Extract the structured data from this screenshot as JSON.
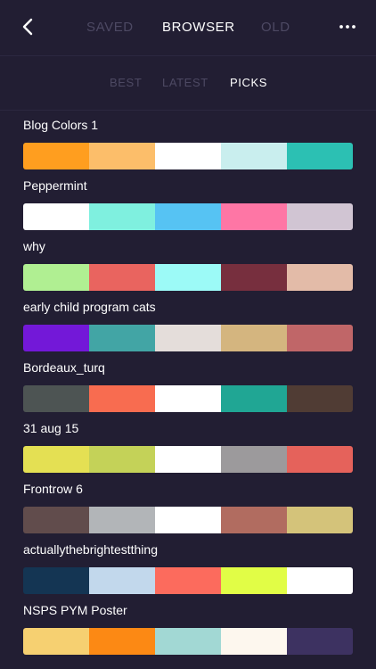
{
  "header": {
    "back_icon": "chevron-left-icon",
    "tabs": [
      {
        "label": "SAVED",
        "active": false
      },
      {
        "label": "BROWSER",
        "active": true
      },
      {
        "label": "OLD",
        "active": false
      }
    ],
    "more_icon": "more-horizontal-icon"
  },
  "subtabs": [
    {
      "label": "BEST",
      "active": false
    },
    {
      "label": "LATEST",
      "active": false
    },
    {
      "label": "PICKS",
      "active": true
    }
  ],
  "palettes": [
    {
      "name": "Blog Colors 1",
      "colors": [
        "#ff9e1f",
        "#fcbe6a",
        "#ffffff",
        "#c9eeee",
        "#2cc0b3"
      ]
    },
    {
      "name": "Peppermint",
      "colors": [
        "#ffffff",
        "#7ff0df",
        "#56c3f3",
        "#fe76a5",
        "#d1c5d3"
      ]
    },
    {
      "name": "why",
      "colors": [
        "#b0ef92",
        "#e9645f",
        "#9cfaf7",
        "#772f3e",
        "#e3bba8"
      ]
    },
    {
      "name": "early child program cats",
      "colors": [
        "#7318d8",
        "#42a5a5",
        "#e4ddda",
        "#d4b57f",
        "#c06668"
      ]
    },
    {
      "name": "Bordeaux_turq",
      "colors": [
        "#4d5453",
        "#f86c50",
        "#ffffff",
        "#20a694",
        "#503c34"
      ]
    },
    {
      "name": "31 aug 15",
      "colors": [
        "#e4e053",
        "#c4d258",
        "#ffffff",
        "#9c9a9c",
        "#e5625b"
      ]
    },
    {
      "name": "Frontrow 6",
      "colors": [
        "#614c4c",
        "#b2b5b8",
        "#ffffff",
        "#b16c60",
        "#d4c37a"
      ]
    },
    {
      "name": "actuallythebrightestthing",
      "colors": [
        "#143553",
        "#c2d8ec",
        "#fc6b5d",
        "#e1fd46",
        "#ffffff"
      ]
    },
    {
      "name": "NSPS PYM Poster",
      "colors": [
        "#f6d071",
        "#fc8914",
        "#a2d8d4",
        "#fdf7ee",
        "#3d3261"
      ]
    }
  ]
}
